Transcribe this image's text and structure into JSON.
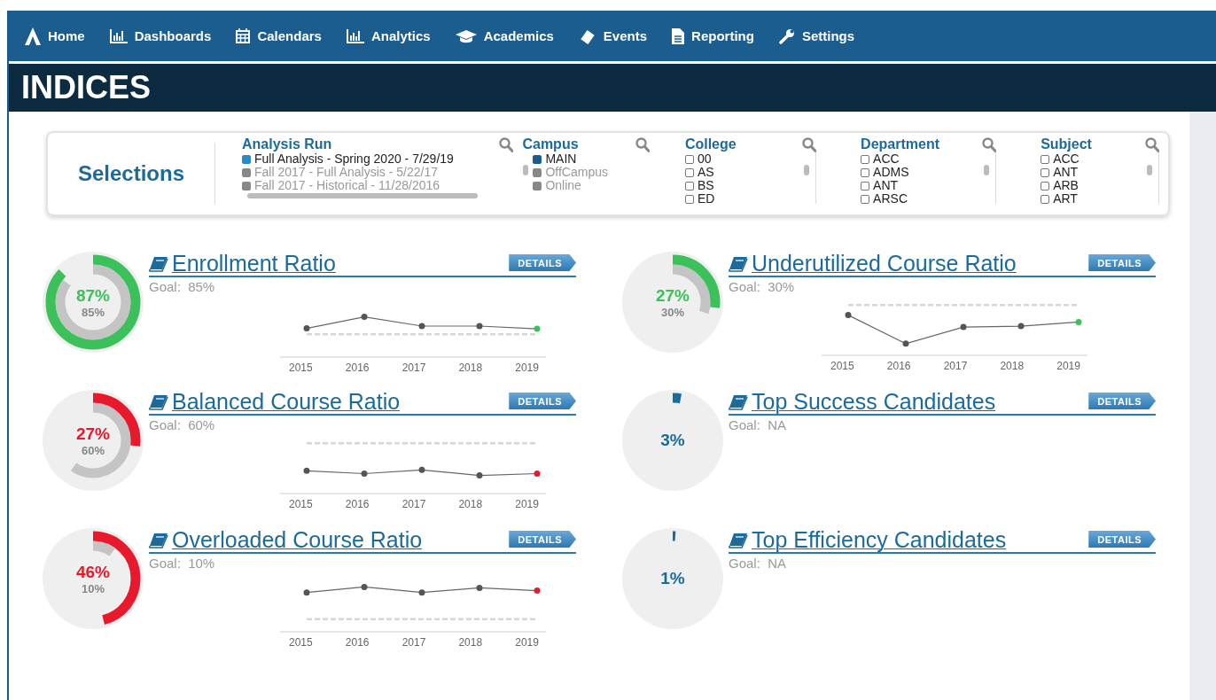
{
  "nav": {
    "items": [
      {
        "label": "Home"
      },
      {
        "label": "Dashboards"
      },
      {
        "label": "Calendars"
      },
      {
        "label": "Analytics"
      },
      {
        "label": "Academics"
      },
      {
        "label": "Events"
      },
      {
        "label": "Reporting"
      },
      {
        "label": "Settings"
      }
    ]
  },
  "page_title": "INDICES",
  "selections": {
    "title": "Selections",
    "filters": [
      {
        "title": "Analysis Run",
        "items": [
          {
            "label": "Full Analysis - Spring 2020 - 7/29/19",
            "checked": true,
            "disabled": false
          },
          {
            "label": "Fall 2017 - Full Analysis - 5/22/17",
            "checked": false,
            "disabled": true
          },
          {
            "label": "Fall 2017 - Historical - 11/28/2016",
            "checked": false,
            "disabled": true
          }
        ]
      },
      {
        "title": "Campus",
        "items": [
          {
            "label": "MAIN",
            "checked": true,
            "disabled": false
          },
          {
            "label": "OffCampus",
            "checked": false,
            "disabled": true
          },
          {
            "label": "Online",
            "checked": false,
            "disabled": true
          }
        ]
      },
      {
        "title": "College",
        "items": [
          {
            "label": "00",
            "checked": false,
            "disabled": false
          },
          {
            "label": "AS",
            "checked": false,
            "disabled": false
          },
          {
            "label": "BS",
            "checked": false,
            "disabled": false
          },
          {
            "label": "ED",
            "checked": false,
            "disabled": false
          }
        ]
      },
      {
        "title": "Department",
        "items": [
          {
            "label": "ACC",
            "checked": false,
            "disabled": false
          },
          {
            "label": "ADMS",
            "checked": false,
            "disabled": false
          },
          {
            "label": "ANT",
            "checked": false,
            "disabled": false
          },
          {
            "label": "ARSC",
            "checked": false,
            "disabled": false
          }
        ]
      },
      {
        "title": "Subject",
        "items": [
          {
            "label": "ACC",
            "checked": false,
            "disabled": false
          },
          {
            "label": "ANT",
            "checked": false,
            "disabled": false
          },
          {
            "label": "ARB",
            "checked": false,
            "disabled": false
          },
          {
            "label": "ART",
            "checked": false,
            "disabled": false
          }
        ]
      }
    ]
  },
  "cards": [
    {
      "title": "Enrollment Ratio",
      "goal": "Goal:  85%",
      "value": "87%",
      "goal_value": "85%",
      "color": "#3cc15a",
      "level": 0.87,
      "button": "DETAILS",
      "years": [
        "2015",
        "2016",
        "2017",
        "2018",
        "2019"
      ]
    },
    {
      "title": "Underutilized Course Ratio",
      "goal": "Goal:  30%",
      "value": "27%",
      "goal_value": "30%",
      "color": "#3cc15a",
      "level": 0.27,
      "button": "DETAILS",
      "years": [
        "2015",
        "2016",
        "2017",
        "2018",
        "2019"
      ]
    },
    {
      "title": "Balanced Course Ratio",
      "goal": "Goal:  60%",
      "value": "27%",
      "goal_value": "60%",
      "color": "#e8192c",
      "level": 0.27,
      "button": "DETAILS",
      "years": [
        "2015",
        "2016",
        "2017",
        "2018",
        "2019"
      ]
    },
    {
      "title": "Top Success Candidates",
      "goal": "Goal:  NA",
      "value": "3%",
      "color": "#1b6a9c",
      "level": 0.03,
      "button": "DETAILS"
    },
    {
      "title": "Overloaded Course Ratio",
      "goal": "Goal:  10%",
      "value": "46%",
      "goal_value": "10%",
      "color": "#e8192c",
      "level": 0.46,
      "button": "DETAILS",
      "years": [
        "2015",
        "2016",
        "2017",
        "2018",
        "2019"
      ]
    },
    {
      "title": "Top Efficiency Candidates",
      "goal": "Goal:  NA",
      "value": "1%",
      "color": "#1b6a9c",
      "level": 0.01,
      "button": "DETAILS"
    }
  ]
}
